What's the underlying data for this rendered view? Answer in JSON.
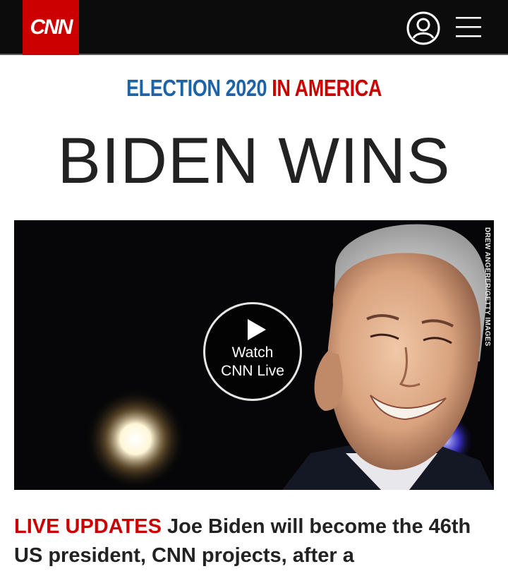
{
  "header": {
    "logo_text": "CNN",
    "account_icon": "user-circle-icon",
    "menu_icon": "hamburger-menu-icon",
    "colors": {
      "bar": "#0c0c0c",
      "brand": "#cc0000"
    }
  },
  "kicker": {
    "part1": "ELECTION 2020",
    "part2": "IN AMERICA",
    "colors": {
      "part1": "#1d63a8",
      "part2": "#cc0000"
    }
  },
  "headline": "BIDEN WINS",
  "video": {
    "play_icon": "play-icon",
    "label_line1": "Watch",
    "label_line2": "CNN Live",
    "credit": "DREW ANGERER/GETTY IMAGES"
  },
  "story": {
    "label": "LIVE UPDATES",
    "text": "Joe Biden will become the 46th US president, CNN projects, after a"
  }
}
